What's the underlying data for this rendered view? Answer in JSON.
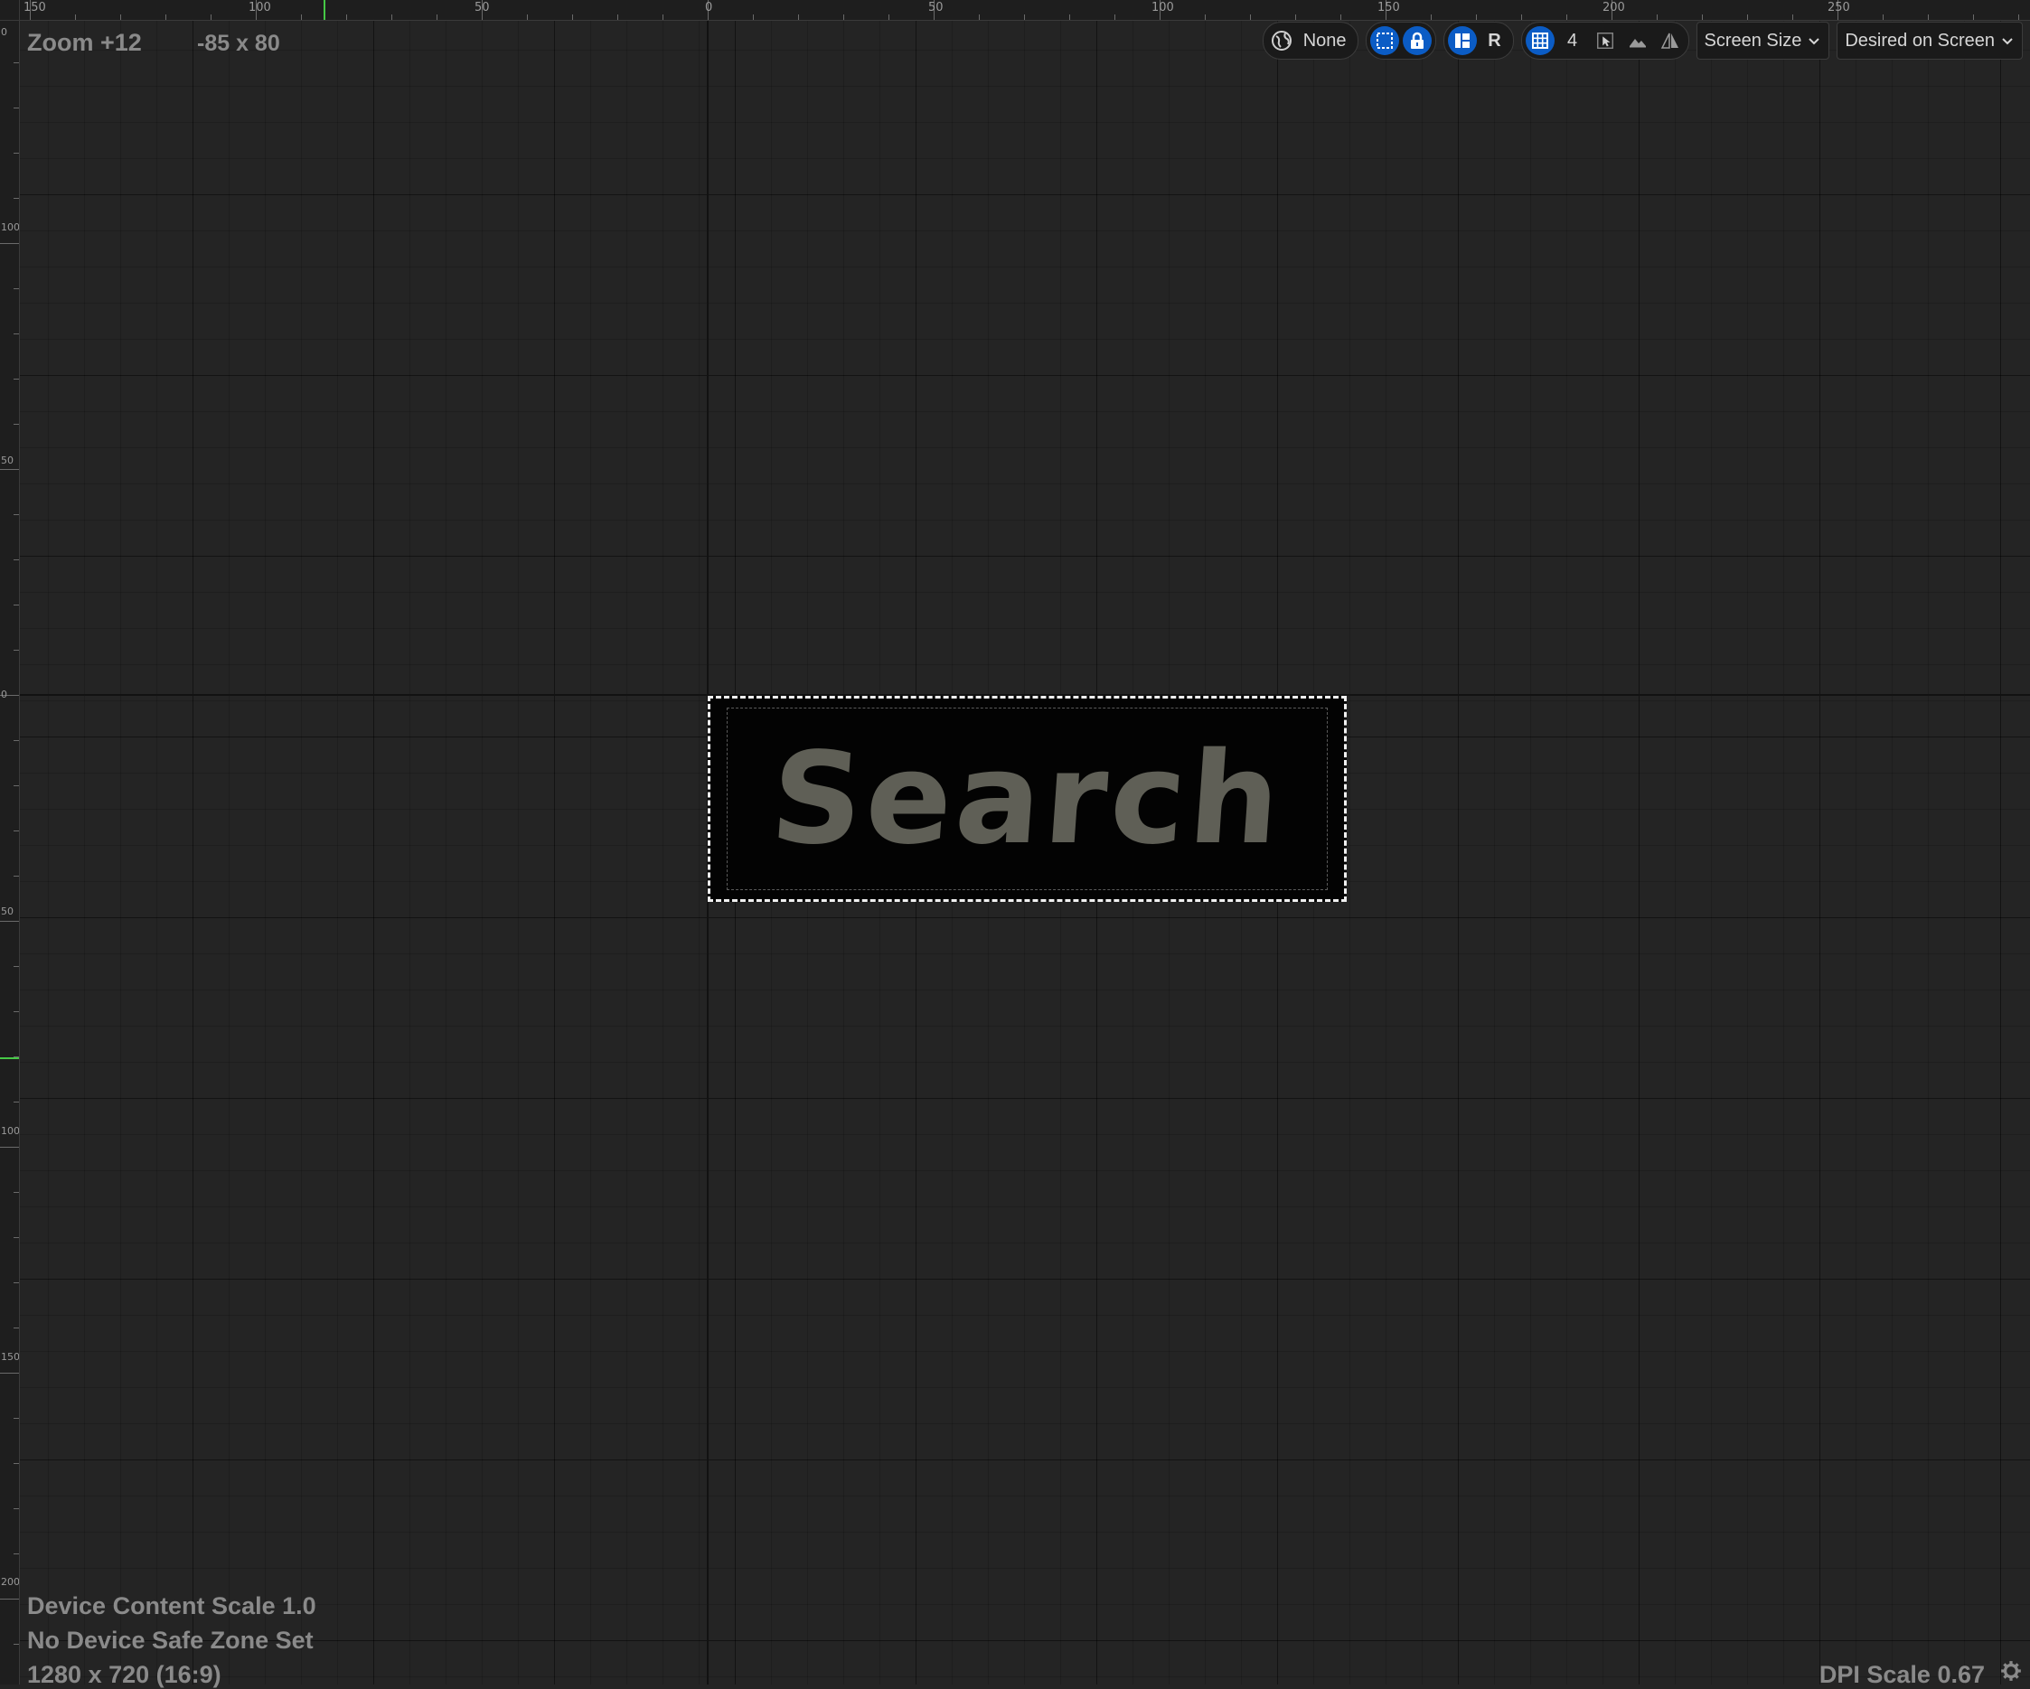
{
  "ruler": {
    "top_labels": [
      "150",
      "100",
      "50",
      "0",
      "50",
      "100",
      "150",
      "200",
      "250"
    ],
    "left_labels": [
      "0",
      "100",
      "50",
      "0",
      "50",
      "100",
      "150",
      "200"
    ]
  },
  "overlay": {
    "zoom": "Zoom +12",
    "size": "-85 x 80",
    "device_content_scale": "Device Content Scale 1.0",
    "safe_zone": "No Device Safe Zone Set",
    "resolution": "1280 x 720 (16:9)",
    "dpi_scale": "DPI Scale 0.67"
  },
  "toolbar": {
    "world_label": "None",
    "reset_label": "R",
    "grid_size": "4",
    "screen_size_label": "Screen Size",
    "desired_label": "Desired on Screen"
  },
  "widget": {
    "text": "Search"
  },
  "colors": {
    "accent": "#0b5cc5",
    "background": "#242424",
    "ruler_marker": "#46c846"
  }
}
